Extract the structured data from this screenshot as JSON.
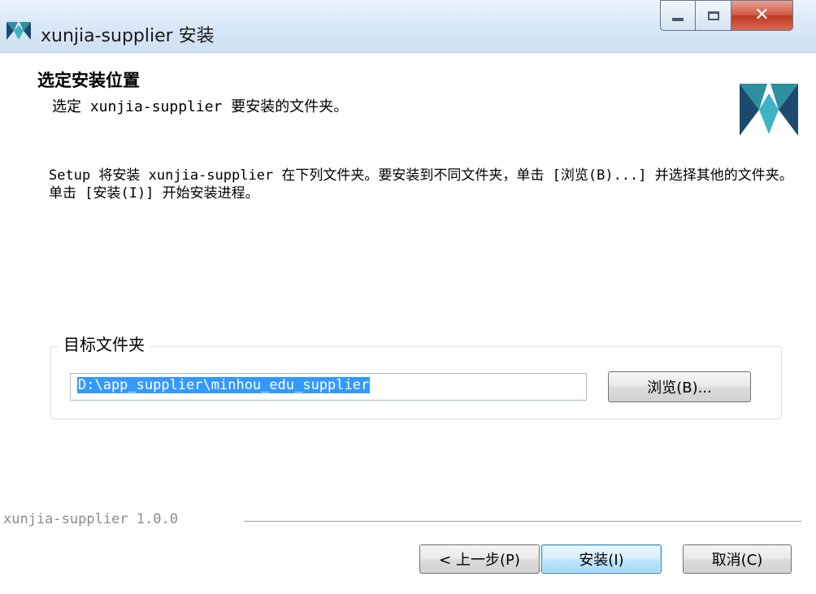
{
  "window": {
    "title": "xunjia-supplier 安装",
    "colors": {
      "accent": "#3399ff",
      "close": "#c8452d",
      "logo_teal": "#2e8fa0",
      "logo_dark": "#1c4a6e"
    }
  },
  "header": {
    "title": "选定安装位置",
    "subtitle": "选定 xunjia-supplier 要安装的文件夹。",
    "logo_icon": "xunjia-logo-icon"
  },
  "body": {
    "description": "Setup 将安装 xunjia-supplier 在下列文件夹。要安装到不同文件夹，单击 [浏览(B)...] 并选择其他的文件夹。 单击 [安装(I)] 开始安装进程。"
  },
  "destination": {
    "group_label": "目标文件夹",
    "path_value": "D:\\app_supplier\\minhou_edu_supplier",
    "browse_label": "浏览(B)..."
  },
  "footer": {
    "brand_text": "xunjia-supplier 1.0.0",
    "back_label": "< 上一步(P)",
    "install_label": "安装(I)",
    "cancel_label": "取消(C)"
  }
}
